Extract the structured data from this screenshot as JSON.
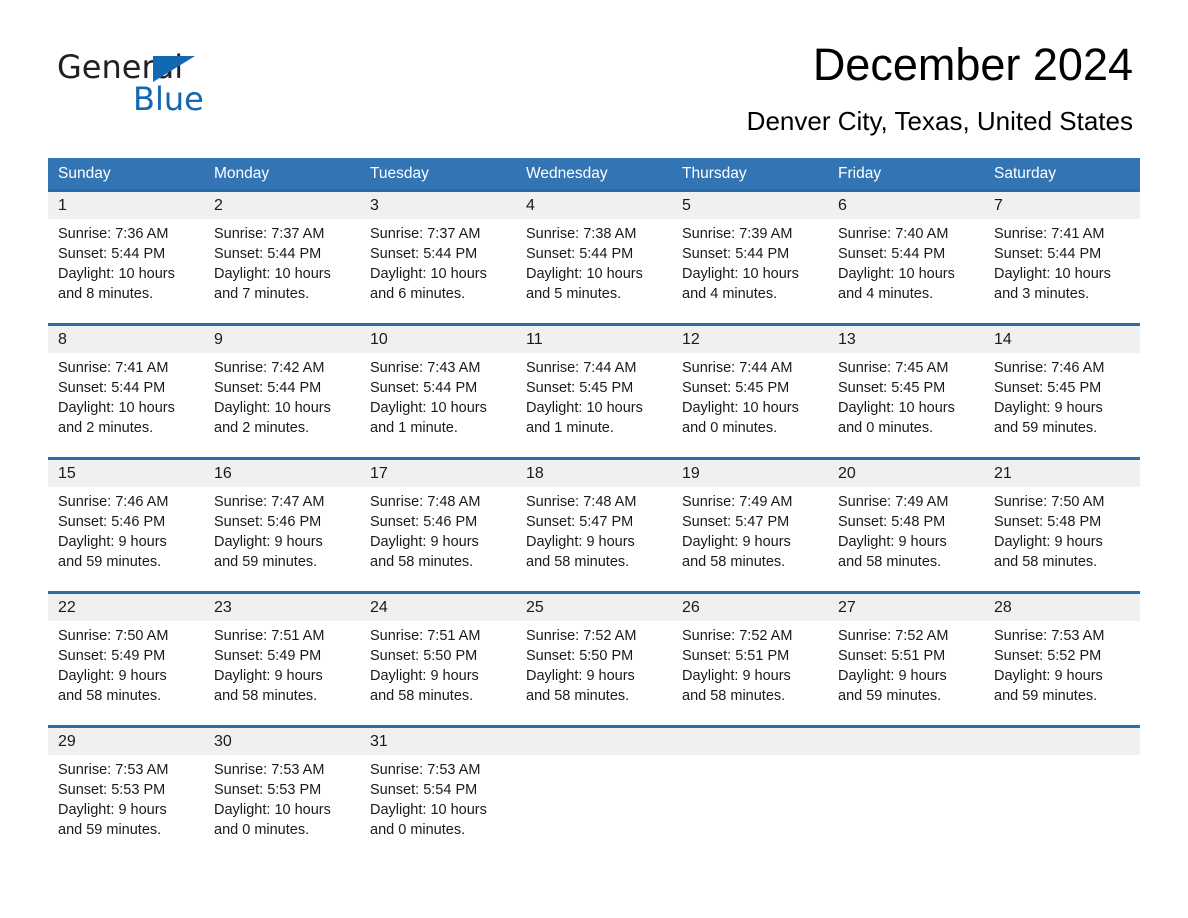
{
  "brand": {
    "name_part1": "General",
    "name_part2": "Blue",
    "triangle_color": "#1268b3"
  },
  "header": {
    "title": "December 2024",
    "subtitle": "Denver City, Texas, United States"
  },
  "colors": {
    "header_blue": "#3375b4",
    "rule_blue": "#2a6ca8",
    "daynum_bg": "#f0f0f0",
    "cell_bg": "#ffffff",
    "text": "#1a1a1a"
  },
  "weekdays": [
    "Sunday",
    "Monday",
    "Tuesday",
    "Wednesday",
    "Thursday",
    "Friday",
    "Saturday"
  ],
  "weeks": [
    {
      "days": [
        {
          "num": "1",
          "sunrise": "Sunrise: 7:36 AM",
          "sunset": "Sunset: 5:44 PM",
          "daylight1": "Daylight: 10 hours",
          "daylight2": "and 8 minutes."
        },
        {
          "num": "2",
          "sunrise": "Sunrise: 7:37 AM",
          "sunset": "Sunset: 5:44 PM",
          "daylight1": "Daylight: 10 hours",
          "daylight2": "and 7 minutes."
        },
        {
          "num": "3",
          "sunrise": "Sunrise: 7:37 AM",
          "sunset": "Sunset: 5:44 PM",
          "daylight1": "Daylight: 10 hours",
          "daylight2": "and 6 minutes."
        },
        {
          "num": "4",
          "sunrise": "Sunrise: 7:38 AM",
          "sunset": "Sunset: 5:44 PM",
          "daylight1": "Daylight: 10 hours",
          "daylight2": "and 5 minutes."
        },
        {
          "num": "5",
          "sunrise": "Sunrise: 7:39 AM",
          "sunset": "Sunset: 5:44 PM",
          "daylight1": "Daylight: 10 hours",
          "daylight2": "and 4 minutes."
        },
        {
          "num": "6",
          "sunrise": "Sunrise: 7:40 AM",
          "sunset": "Sunset: 5:44 PM",
          "daylight1": "Daylight: 10 hours",
          "daylight2": "and 4 minutes."
        },
        {
          "num": "7",
          "sunrise": "Sunrise: 7:41 AM",
          "sunset": "Sunset: 5:44 PM",
          "daylight1": "Daylight: 10 hours",
          "daylight2": "and 3 minutes."
        }
      ]
    },
    {
      "days": [
        {
          "num": "8",
          "sunrise": "Sunrise: 7:41 AM",
          "sunset": "Sunset: 5:44 PM",
          "daylight1": "Daylight: 10 hours",
          "daylight2": "and 2 minutes."
        },
        {
          "num": "9",
          "sunrise": "Sunrise: 7:42 AM",
          "sunset": "Sunset: 5:44 PM",
          "daylight1": "Daylight: 10 hours",
          "daylight2": "and 2 minutes."
        },
        {
          "num": "10",
          "sunrise": "Sunrise: 7:43 AM",
          "sunset": "Sunset: 5:44 PM",
          "daylight1": "Daylight: 10 hours",
          "daylight2": "and 1 minute."
        },
        {
          "num": "11",
          "sunrise": "Sunrise: 7:44 AM",
          "sunset": "Sunset: 5:45 PM",
          "daylight1": "Daylight: 10 hours",
          "daylight2": "and 1 minute."
        },
        {
          "num": "12",
          "sunrise": "Sunrise: 7:44 AM",
          "sunset": "Sunset: 5:45 PM",
          "daylight1": "Daylight: 10 hours",
          "daylight2": "and 0 minutes."
        },
        {
          "num": "13",
          "sunrise": "Sunrise: 7:45 AM",
          "sunset": "Sunset: 5:45 PM",
          "daylight1": "Daylight: 10 hours",
          "daylight2": "and 0 minutes."
        },
        {
          "num": "14",
          "sunrise": "Sunrise: 7:46 AM",
          "sunset": "Sunset: 5:45 PM",
          "daylight1": "Daylight: 9 hours",
          "daylight2": "and 59 minutes."
        }
      ]
    },
    {
      "days": [
        {
          "num": "15",
          "sunrise": "Sunrise: 7:46 AM",
          "sunset": "Sunset: 5:46 PM",
          "daylight1": "Daylight: 9 hours",
          "daylight2": "and 59 minutes."
        },
        {
          "num": "16",
          "sunrise": "Sunrise: 7:47 AM",
          "sunset": "Sunset: 5:46 PM",
          "daylight1": "Daylight: 9 hours",
          "daylight2": "and 59 minutes."
        },
        {
          "num": "17",
          "sunrise": "Sunrise: 7:48 AM",
          "sunset": "Sunset: 5:46 PM",
          "daylight1": "Daylight: 9 hours",
          "daylight2": "and 58 minutes."
        },
        {
          "num": "18",
          "sunrise": "Sunrise: 7:48 AM",
          "sunset": "Sunset: 5:47 PM",
          "daylight1": "Daylight: 9 hours",
          "daylight2": "and 58 minutes."
        },
        {
          "num": "19",
          "sunrise": "Sunrise: 7:49 AM",
          "sunset": "Sunset: 5:47 PM",
          "daylight1": "Daylight: 9 hours",
          "daylight2": "and 58 minutes."
        },
        {
          "num": "20",
          "sunrise": "Sunrise: 7:49 AM",
          "sunset": "Sunset: 5:48 PM",
          "daylight1": "Daylight: 9 hours",
          "daylight2": "and 58 minutes."
        },
        {
          "num": "21",
          "sunrise": "Sunrise: 7:50 AM",
          "sunset": "Sunset: 5:48 PM",
          "daylight1": "Daylight: 9 hours",
          "daylight2": "and 58 minutes."
        }
      ]
    },
    {
      "days": [
        {
          "num": "22",
          "sunrise": "Sunrise: 7:50 AM",
          "sunset": "Sunset: 5:49 PM",
          "daylight1": "Daylight: 9 hours",
          "daylight2": "and 58 minutes."
        },
        {
          "num": "23",
          "sunrise": "Sunrise: 7:51 AM",
          "sunset": "Sunset: 5:49 PM",
          "daylight1": "Daylight: 9 hours",
          "daylight2": "and 58 minutes."
        },
        {
          "num": "24",
          "sunrise": "Sunrise: 7:51 AM",
          "sunset": "Sunset: 5:50 PM",
          "daylight1": "Daylight: 9 hours",
          "daylight2": "and 58 minutes."
        },
        {
          "num": "25",
          "sunrise": "Sunrise: 7:52 AM",
          "sunset": "Sunset: 5:50 PM",
          "daylight1": "Daylight: 9 hours",
          "daylight2": "and 58 minutes."
        },
        {
          "num": "26",
          "sunrise": "Sunrise: 7:52 AM",
          "sunset": "Sunset: 5:51 PM",
          "daylight1": "Daylight: 9 hours",
          "daylight2": "and 58 minutes."
        },
        {
          "num": "27",
          "sunrise": "Sunrise: 7:52 AM",
          "sunset": "Sunset: 5:51 PM",
          "daylight1": "Daylight: 9 hours",
          "daylight2": "and 59 minutes."
        },
        {
          "num": "28",
          "sunrise": "Sunrise: 7:53 AM",
          "sunset": "Sunset: 5:52 PM",
          "daylight1": "Daylight: 9 hours",
          "daylight2": "and 59 minutes."
        }
      ]
    },
    {
      "days": [
        {
          "num": "29",
          "sunrise": "Sunrise: 7:53 AM",
          "sunset": "Sunset: 5:53 PM",
          "daylight1": "Daylight: 9 hours",
          "daylight2": "and 59 minutes."
        },
        {
          "num": "30",
          "sunrise": "Sunrise: 7:53 AM",
          "sunset": "Sunset: 5:53 PM",
          "daylight1": "Daylight: 10 hours",
          "daylight2": "and 0 minutes."
        },
        {
          "num": "31",
          "sunrise": "Sunrise: 7:53 AM",
          "sunset": "Sunset: 5:54 PM",
          "daylight1": "Daylight: 10 hours",
          "daylight2": "and 0 minutes."
        },
        {
          "num": "",
          "sunrise": "",
          "sunset": "",
          "daylight1": "",
          "daylight2": ""
        },
        {
          "num": "",
          "sunrise": "",
          "sunset": "",
          "daylight1": "",
          "daylight2": ""
        },
        {
          "num": "",
          "sunrise": "",
          "sunset": "",
          "daylight1": "",
          "daylight2": ""
        },
        {
          "num": "",
          "sunrise": "",
          "sunset": "",
          "daylight1": "",
          "daylight2": ""
        }
      ]
    }
  ]
}
